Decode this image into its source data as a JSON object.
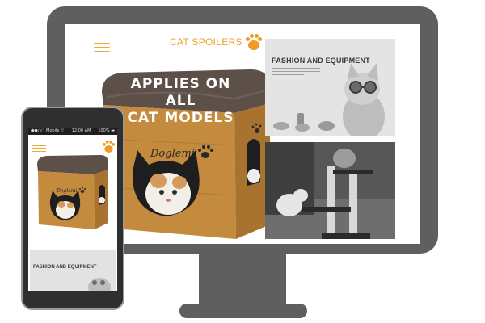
{
  "desktop": {
    "brand_name": "CAT SPOILERS",
    "headline_line1": "APPLIES ON ALL",
    "headline_line2": "CAT MODELS",
    "product_brand": "Doglemi",
    "panel1_title": "FASHION AND EQUIPMENT"
  },
  "phone": {
    "status_left": "●●○○ Mobile ⌔",
    "status_center": "12:00 AM",
    "status_right": "100% ▬",
    "product_brand": "Doglemi",
    "panel_title": "FASHION AND EQUIPMENT"
  },
  "colors": {
    "accent": "#f39a22",
    "monitor_frame": "#5f5f5f",
    "phone_frame": "#2f2f2f",
    "cube_wood": "#c48a3e",
    "cube_cushion": "#5c5048"
  },
  "icons": [
    "hamburger-menu-icon",
    "paw-icon",
    "cat-ear-cutout-icon"
  ]
}
